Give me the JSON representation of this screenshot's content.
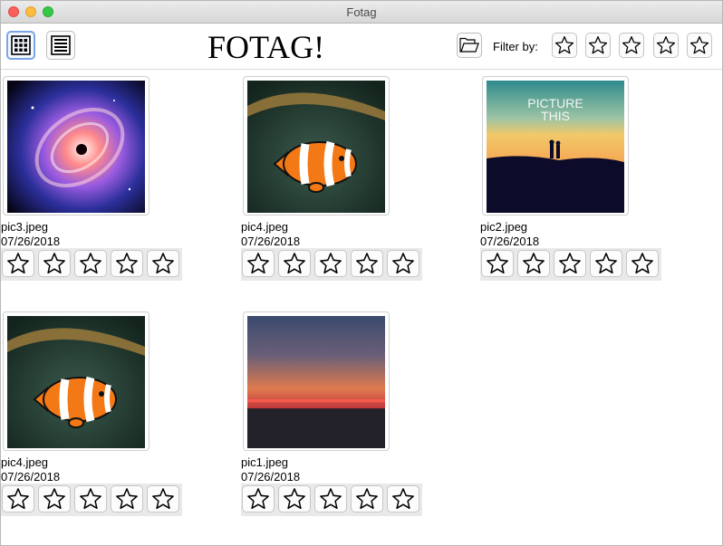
{
  "window": {
    "title": "Fotag"
  },
  "toolbar": {
    "app_title": "FOTAG!",
    "grid_view_icon": "grid-view-icon",
    "list_view_icon": "list-view-icon",
    "open_folder_icon": "folder-open-icon",
    "filter_label": "Filter by:",
    "filter_stars": 5,
    "selected_view": "grid"
  },
  "images": [
    {
      "name": "pic3.jpeg",
      "date": "07/26/2018",
      "rating": 0,
      "subject": "black-hole"
    },
    {
      "name": "pic4.jpeg",
      "date": "07/26/2018",
      "rating": 0,
      "subject": "clownfish"
    },
    {
      "name": "pic2.jpeg",
      "date": "07/26/2018",
      "rating": 0,
      "subject": "couple-at-sunset",
      "overlay_text": "PICTURE THIS"
    },
    {
      "name": "pic4.jpeg",
      "date": "07/26/2018",
      "rating": 0,
      "subject": "clownfish"
    },
    {
      "name": "pic1.jpeg",
      "date": "07/26/2018",
      "rating": 0,
      "subject": "moon-over-sea"
    }
  ],
  "colors": {
    "selected_border": "#7aa6e6"
  }
}
